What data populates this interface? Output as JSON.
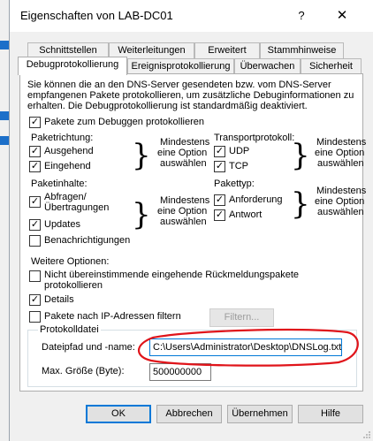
{
  "window": {
    "title": "Eigenschaften von LAB-DC01",
    "help_glyph": "?",
    "close_glyph": "✕"
  },
  "tabs_row1": [
    "Schnittstellen",
    "Weiterleitungen",
    "Erweitert",
    "Stammhinweise"
  ],
  "tabs_row2": [
    "Debugprotokollierung",
    "Ereignisprotokollierung",
    "Überwachen",
    "Sicherheit"
  ],
  "description": [
    "Sie können die an den DNS-Server gesendeten bzw. vom DNS-Server",
    "empfangenen Pakete protokollieren, um zusätzliche Debuginformationen zu",
    "erhalten. Die Debugprotokollierung ist standardmäßig deaktiviert."
  ],
  "log_packets": {
    "label": "Pakete zum Debuggen protokollieren",
    "checked": true
  },
  "direction": {
    "title": "Paketrichtung:",
    "outgoing": "Ausgehend",
    "incoming": "Eingehend",
    "note": [
      "Mindestens",
      "eine Option",
      "auswählen"
    ]
  },
  "transport": {
    "title": "Transportprotokoll:",
    "udp": "UDP",
    "tcp": "TCP",
    "note": [
      "Mindestens",
      "eine Option",
      "auswählen"
    ]
  },
  "contents": {
    "title": "Paketinhalte:",
    "queries": [
      "Abfragen/",
      "Übertragungen"
    ],
    "updates": "Updates",
    "notifications": "Benachrichtigungen",
    "note": [
      "Mindestens",
      "eine Option",
      "auswählen"
    ]
  },
  "packet_type": {
    "title": "Pakettyp:",
    "request": "Anforderung",
    "response": "Antwort",
    "note": [
      "Mindestens",
      "eine Option",
      "auswählen"
    ]
  },
  "further": {
    "title": "Weitere Optionen:",
    "unmatched": [
      "Nicht übereinstimmende eingehende Rückmeldungspakete",
      "protokollieren"
    ],
    "details": "Details",
    "filter_ip": "Pakete nach IP-Adressen filtern",
    "filter_button": "Filtern..."
  },
  "logfile": {
    "title": "Protokolldatei",
    "path_label": "Dateipfad und -name:",
    "path_value": "C:\\Users\\Administrator\\Desktop\\DNSLog.txt",
    "size_label": "Max. Größe (Byte):",
    "size_value": "500000000"
  },
  "buttons": {
    "ok": "OK",
    "cancel": "Abbrechen",
    "apply": "Übernehmen",
    "help": "Hilfe"
  },
  "colors": {
    "accent": "#0078d7",
    "annotation": "#e0141a"
  },
  "check_glyph": "✓"
}
